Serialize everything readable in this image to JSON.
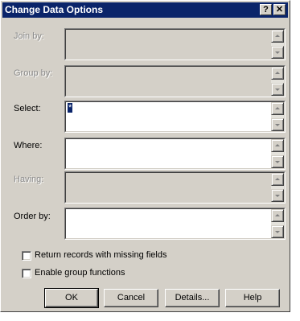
{
  "window": {
    "title": "Change Data Options",
    "help_glyph": "?",
    "close_glyph": "✕"
  },
  "fields": {
    "join_by": {
      "label": "Join by:",
      "value": "",
      "enabled": false
    },
    "group_by": {
      "label": "Group by:",
      "value": "",
      "enabled": false
    },
    "select": {
      "label": "Select:",
      "value": "*",
      "enabled": true
    },
    "where": {
      "label": "Where:",
      "value": "",
      "enabled": true
    },
    "having": {
      "label": "Having:",
      "value": "",
      "enabled": false
    },
    "order_by": {
      "label": "Order by:",
      "value": "",
      "enabled": true
    }
  },
  "options": {
    "return_missing": {
      "label": "Return records with missing fields",
      "checked": false
    },
    "enable_group": {
      "label": "Enable group functions",
      "checked": false
    }
  },
  "buttons": {
    "ok": "OK",
    "cancel": "Cancel",
    "details": "Details...",
    "help": "Help"
  }
}
